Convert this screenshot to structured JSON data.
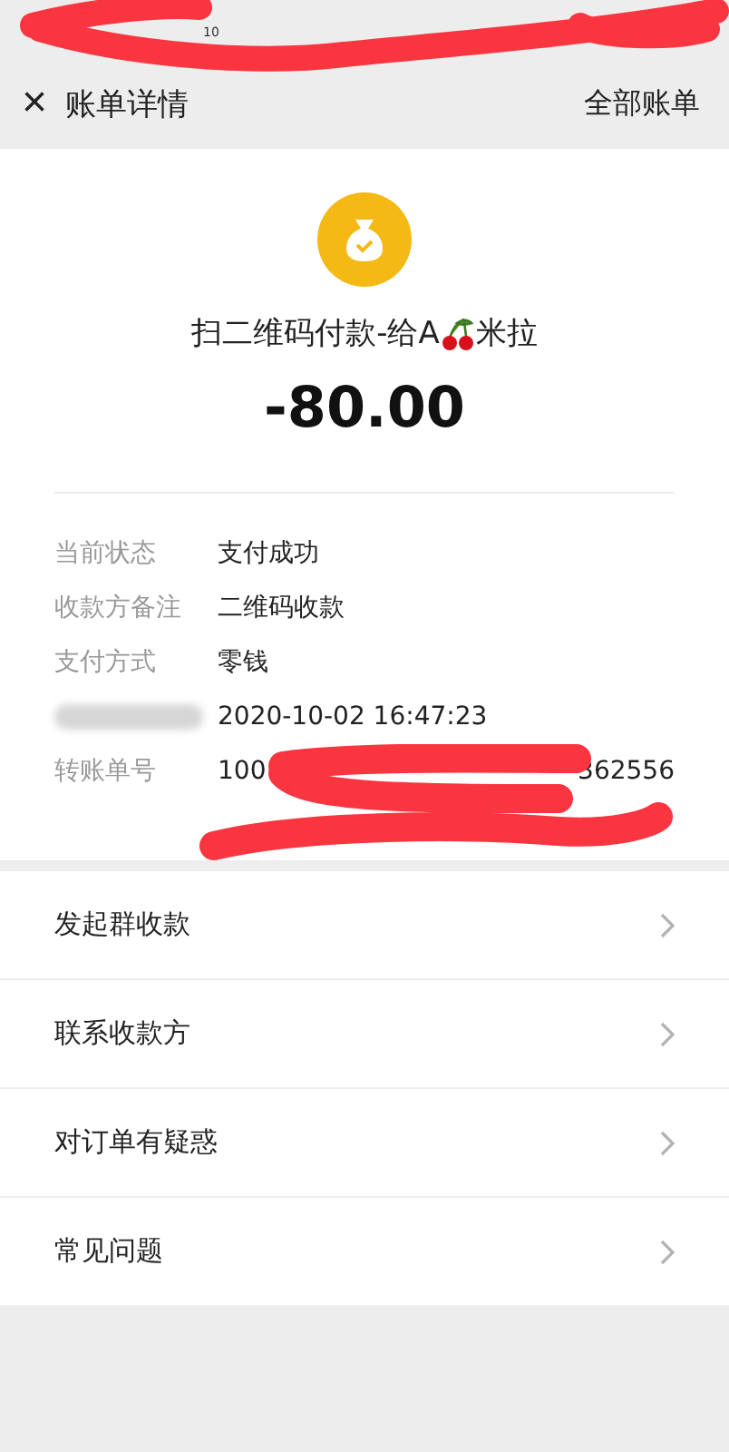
{
  "status_bar": {
    "time": "10"
  },
  "header": {
    "close": "×",
    "title": "账单详情",
    "link": "全部账单"
  },
  "summary": {
    "title_before": "扫二维码付款-给A",
    "title_after": "米拉",
    "amount": "-80.00"
  },
  "details": [
    {
      "label": "当前状态",
      "value": "支付成功"
    },
    {
      "label": "收款方备注",
      "value": "二维码收款"
    },
    {
      "label": "支付方式",
      "value": "零钱"
    },
    {
      "value": "2020-10-02 16:47:23",
      "kind": "blurred"
    },
    {
      "label": "转账单号",
      "value": "100",
      "value_end": "362556",
      "kind": "redacted"
    }
  ],
  "actions": [
    {
      "label": "发起群收款"
    },
    {
      "label": "联系收款方"
    },
    {
      "label": "对订单有疑惑"
    },
    {
      "label": "常见问题"
    }
  ]
}
